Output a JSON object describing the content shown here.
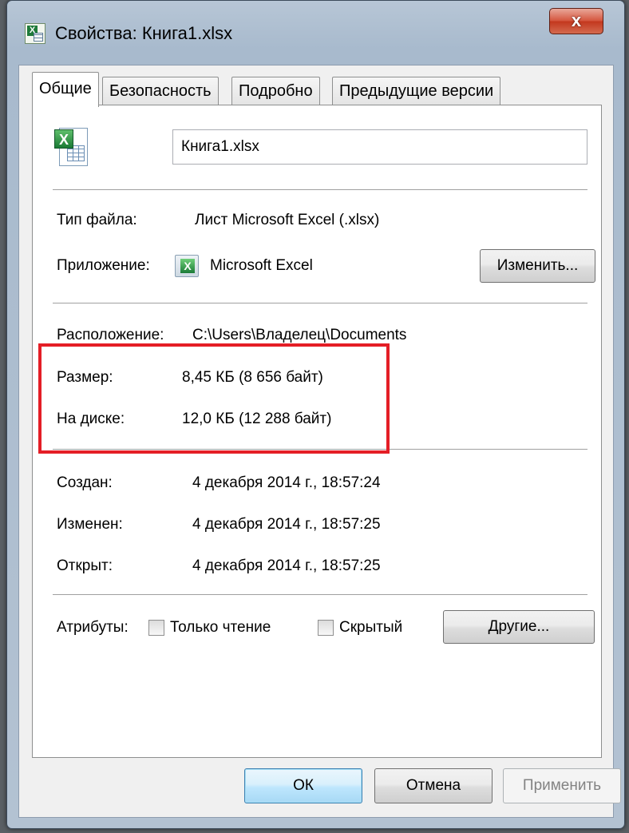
{
  "window": {
    "title": "Свойства: Книга1.xlsx",
    "close_glyph": "x"
  },
  "tabs": [
    {
      "label": "Общие",
      "active": true
    },
    {
      "label": "Безопасность",
      "active": false
    },
    {
      "label": "Подробно",
      "active": false
    },
    {
      "label": "Предыдущие версии",
      "active": false
    }
  ],
  "general": {
    "file_name": "Книга1.xlsx",
    "file_type_label": "Тип файла:",
    "file_type_value": "Лист Microsoft Excel (.xlsx)",
    "app_label": "Приложение:",
    "app_value": "Microsoft Excel",
    "change_button": "Изменить...",
    "location_label": "Расположение:",
    "location_value": "C:\\Users\\Владелец\\Documents",
    "size_label": "Размер:",
    "size_value": "8,45 КБ (8 656 байт)",
    "disk_label": "На диске:",
    "disk_value": "12,0 КБ (12 288 байт)",
    "created_label": "Создан:",
    "created_value": "4 декабря 2014 г., 18:57:24",
    "modified_label": "Изменен:",
    "modified_value": "4 декабря 2014 г., 18:57:25",
    "opened_label": "Открыт:",
    "opened_value": "4 декабря 2014 г., 18:57:25",
    "attributes_label": "Атрибуты:",
    "readonly_label": "Только чтение",
    "readonly_checked": false,
    "hidden_label": "Скрытый",
    "hidden_checked": false,
    "other_button": "Другие..."
  },
  "footer": {
    "ok": "ОК",
    "cancel": "Отмена",
    "apply": "Применить"
  },
  "colors": {
    "highlight": "#e41e26",
    "close_button": "#c3381e"
  },
  "icons": [
    "excel-file-icon",
    "excel-app-icon",
    "close-icon"
  ]
}
